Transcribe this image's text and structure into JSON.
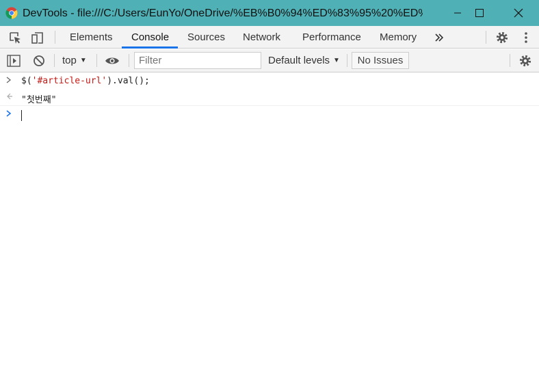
{
  "window": {
    "title": "DevTools - file:///C:/Users/EunYo/OneDrive/%EB%B0%94%ED%83%95%20%ED%99..."
  },
  "tabs": [
    {
      "label": "Elements"
    },
    {
      "label": "Console"
    },
    {
      "label": "Sources"
    },
    {
      "label": "Network"
    },
    {
      "label": "Performance"
    },
    {
      "label": "Memory"
    }
  ],
  "toolbar": {
    "context": "top",
    "filter_placeholder": "Filter",
    "levels": "Default levels",
    "issues": "No Issues"
  },
  "console": {
    "input_prefix": "$(",
    "input_string": "'#article-url'",
    "input_suffix": ").val();",
    "result": "\"첫번째\""
  },
  "colors": {
    "titlebar": "#4fb0b5",
    "active_tab_underline": "#1a73e8",
    "string": "#c41a16"
  }
}
